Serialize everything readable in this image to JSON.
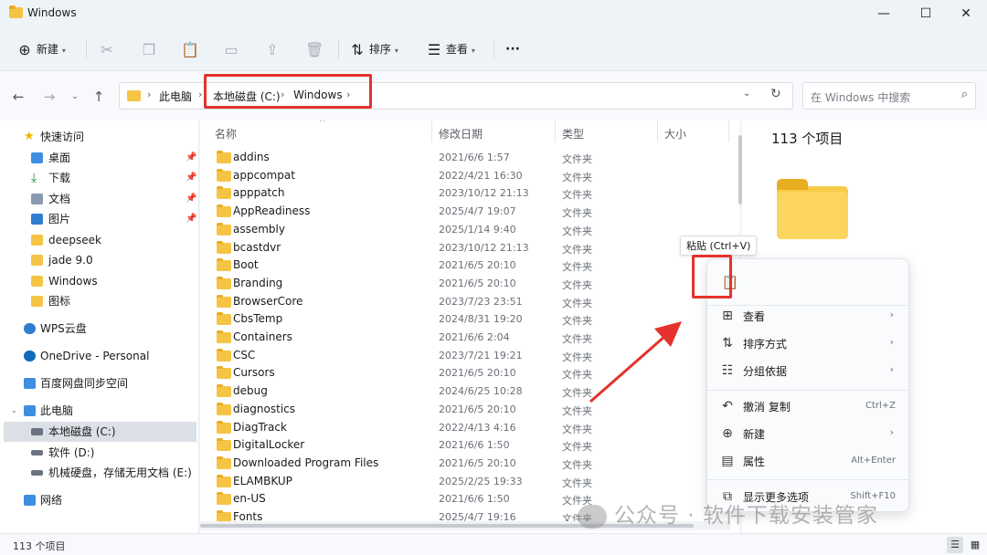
{
  "window": {
    "title": "Windows",
    "minimize": "—",
    "maximize": "☐",
    "close": "✕"
  },
  "toolbar": {
    "new_label": "新建",
    "sort_label": "排序",
    "view_label": "查看",
    "more": "···"
  },
  "address": {
    "crumbs": [
      "此电脑",
      "本地磁盘 (C:)",
      "Windows"
    ],
    "search_placeholder": "在 Windows 中搜索"
  },
  "sidebar": {
    "quick_access": "快速访问",
    "items": [
      {
        "label": "桌面",
        "icon": "desktop-icon",
        "pinned": true
      },
      {
        "label": "下载",
        "icon": "download-icon",
        "pinned": true
      },
      {
        "label": "文档",
        "icon": "document-icon",
        "pinned": true
      },
      {
        "label": "图片",
        "icon": "picture-icon",
        "pinned": true
      },
      {
        "label": "deepseek",
        "icon": "folder-icon"
      },
      {
        "label": "jade 9.0",
        "icon": "folder-icon"
      },
      {
        "label": "Windows",
        "icon": "folder-icon"
      },
      {
        "label": "图标",
        "icon": "folder-icon"
      }
    ],
    "wps": "WPS云盘",
    "onedrive": "OneDrive - Personal",
    "baidu": "百度网盘同步空间",
    "this_pc": "此电脑",
    "drives": [
      {
        "label": "本地磁盘 (C:)",
        "selected": true
      },
      {
        "label": "软件 (D:)"
      },
      {
        "label": "机械硬盘，存储无用文档 (E:)"
      }
    ],
    "network": "网络"
  },
  "columns": {
    "name": "名称",
    "date": "修改日期",
    "type": "类型",
    "size": "大小"
  },
  "files": [
    {
      "name": "addins",
      "date": "2021/6/6 1:57",
      "type": "文件夹"
    },
    {
      "name": "appcompat",
      "date": "2022/4/21 16:30",
      "type": "文件夹"
    },
    {
      "name": "apppatch",
      "date": "2023/10/12 21:13",
      "type": "文件夹"
    },
    {
      "name": "AppReadiness",
      "date": "2025/4/7 19:07",
      "type": "文件夹"
    },
    {
      "name": "assembly",
      "date": "2025/1/14 9:40",
      "type": "文件夹"
    },
    {
      "name": "bcastdvr",
      "date": "2023/10/12 21:13",
      "type": "文件夹"
    },
    {
      "name": "Boot",
      "date": "2021/6/5 20:10",
      "type": "文件夹"
    },
    {
      "name": "Branding",
      "date": "2021/6/5 20:10",
      "type": "文件夹"
    },
    {
      "name": "BrowserCore",
      "date": "2023/7/23 23:51",
      "type": "文件夹"
    },
    {
      "name": "CbsTemp",
      "date": "2024/8/31 19:20",
      "type": "文件夹"
    },
    {
      "name": "Containers",
      "date": "2021/6/6 2:04",
      "type": "文件夹"
    },
    {
      "name": "CSC",
      "date": "2023/7/21 19:21",
      "type": "文件夹"
    },
    {
      "name": "Cursors",
      "date": "2021/6/5 20:10",
      "type": "文件夹"
    },
    {
      "name": "debug",
      "date": "2024/6/25 10:28",
      "type": "文件夹"
    },
    {
      "name": "diagnostics",
      "date": "2021/6/5 20:10",
      "type": "文件夹"
    },
    {
      "name": "DiagTrack",
      "date": "2022/4/13 4:16",
      "type": "文件夹"
    },
    {
      "name": "DigitalLocker",
      "date": "2021/6/6 1:50",
      "type": "文件夹"
    },
    {
      "name": "Downloaded Program Files",
      "date": "2021/6/5 20:10",
      "type": "文件夹"
    },
    {
      "name": "ELAMBKUP",
      "date": "2025/2/25 19:33",
      "type": "文件夹"
    },
    {
      "name": "en-US",
      "date": "2021/6/6 1:50",
      "type": "文件夹"
    },
    {
      "name": "Fonts",
      "date": "2025/4/7 19:16",
      "type": "文件夹"
    }
  ],
  "preview": {
    "count": "113 个项目"
  },
  "tooltip": "粘贴 (Ctrl+V)",
  "context_menu": {
    "items": [
      {
        "label": "查看",
        "icon": "grid-icon",
        "submenu": true
      },
      {
        "label": "排序方式",
        "icon": "sort-icon",
        "submenu": true
      },
      {
        "label": "分组依据",
        "icon": "group-icon",
        "submenu": true
      },
      {
        "label": "撤消 复制",
        "icon": "undo-icon",
        "shortcut": "Ctrl+Z"
      },
      {
        "label": "新建",
        "icon": "new-icon",
        "submenu": true
      },
      {
        "label": "属性",
        "icon": "properties-icon",
        "shortcut": "Alt+Enter"
      },
      {
        "label": "显示更多选项",
        "icon": "more-options-icon",
        "shortcut": "Shift+F10"
      }
    ]
  },
  "status": {
    "count": "113 个项目"
  },
  "watermark": "公众号 · 软件下载安装管家",
  "colors": {
    "accent_red": "#e5322d",
    "folder_yellow": "#f6c445"
  }
}
